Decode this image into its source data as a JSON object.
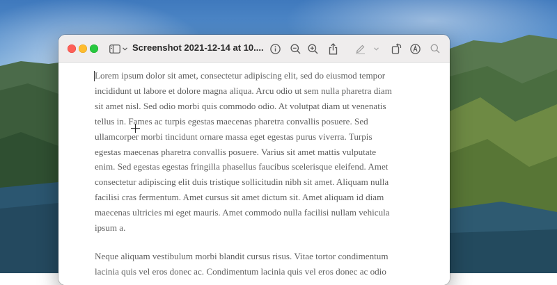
{
  "window": {
    "title": "Screenshot 2021-12-14 at 10....",
    "traffic_lights": {
      "close_color": "#fe5f57",
      "minimize_color": "#febc2e",
      "maximize_color": "#28c840"
    }
  },
  "toolbar": {
    "icons": [
      "sidebar-icon",
      "chevron-down-icon",
      "info-icon",
      "zoom-out-icon",
      "zoom-in-icon",
      "share-icon",
      "highlight-pen-icon",
      "chevron-down-icon",
      "rotate-icon",
      "markup-icon",
      "search-icon"
    ]
  },
  "document": {
    "paragraphs": [
      "Lorem ipsum dolor sit amet, consectetur adipiscing elit, sed do eiusmod tempor\nincididunt ut labore et dolore magna aliqua. Arcu odio ut sem nulla pharetra diam\nsit amet nisl. Sed odio morbi quis commodo odio. At volutpat diam ut venenatis\ntellus in. Fames ac turpis egestas maecenas pharetra convallis posuere. Sed\nullamcorper morbi tincidunt ornare massa eget egestas purus viverra. Turpis\negestas maecenas pharetra convallis posuere. Varius sit amet mattis vulputate\nenim. Sed egestas egestas fringilla phasellus faucibus scelerisque eleifend. Amet\nconsectetur adipiscing elit duis tristique sollicitudin nibh sit amet. Aliquam nulla\nfacilisi cras fermentum. Amet cursus sit amet dictum sit. Amet aliquam id diam\nmaecenas ultricies mi eget mauris. Amet commodo nulla facilisi nullam vehicula\nipsum a.",
      "Neque aliquam vestibulum morbi blandit cursus risus. Vitae tortor condimentum\nlacinia quis vel eros donec ac. Condimentum lacinia quis vel eros donec ac odio"
    ]
  }
}
